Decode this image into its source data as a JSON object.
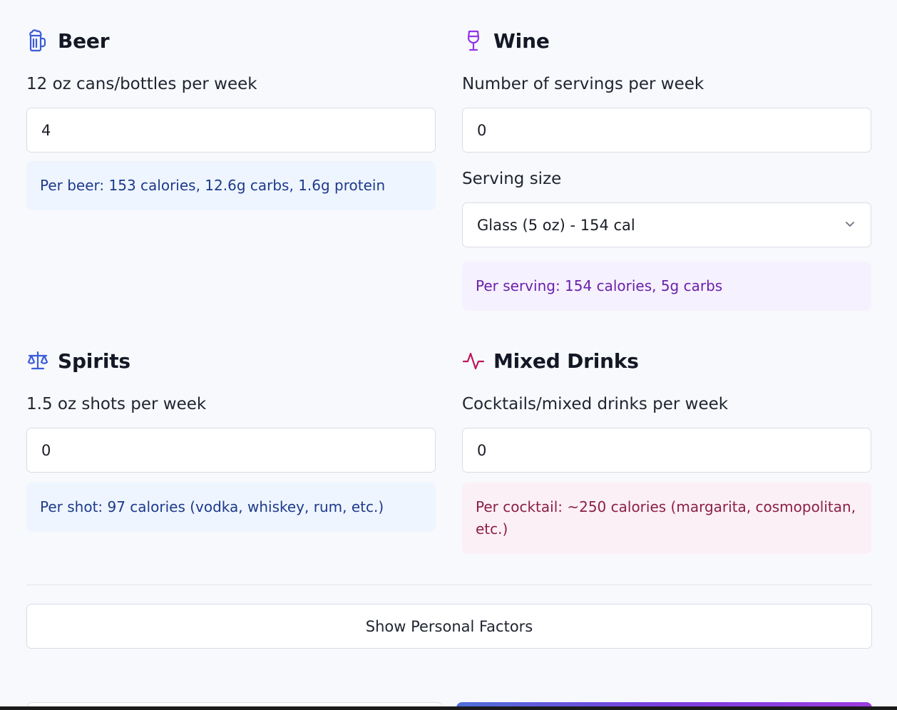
{
  "beer": {
    "title": "Beer",
    "icon": "beer-mug-icon",
    "label": "12 oz cans/bottles per week",
    "value": "4",
    "info": "Per beer: 153 calories, 12.6g carbs, 1.6g protein",
    "color": "#3b5bdb"
  },
  "wine": {
    "title": "Wine",
    "icon": "wine-glass-icon",
    "label": "Number of servings per week",
    "value": "0",
    "serving_label": "Serving size",
    "serving_value": "Glass (5 oz) - 154 cal",
    "info": "Per serving: 154 calories, 5g carbs",
    "color": "#9333ea"
  },
  "spirits": {
    "title": "Spirits",
    "icon": "scale-icon",
    "label": "1.5 oz shots per week",
    "value": "0",
    "info": "Per shot: 97 calories (vodka, whiskey, rum, etc.)",
    "color": "#3b5bdb"
  },
  "mixed": {
    "title": "Mixed Drinks",
    "icon": "activity-icon",
    "label": "Cocktails/mixed drinks per week",
    "value": "0",
    "info": "Per cocktail: ~250 calories (margarita, cosmopolitan, etc.)",
    "color": "#be185d"
  },
  "personal_factors_button": "Show Personal Factors"
}
